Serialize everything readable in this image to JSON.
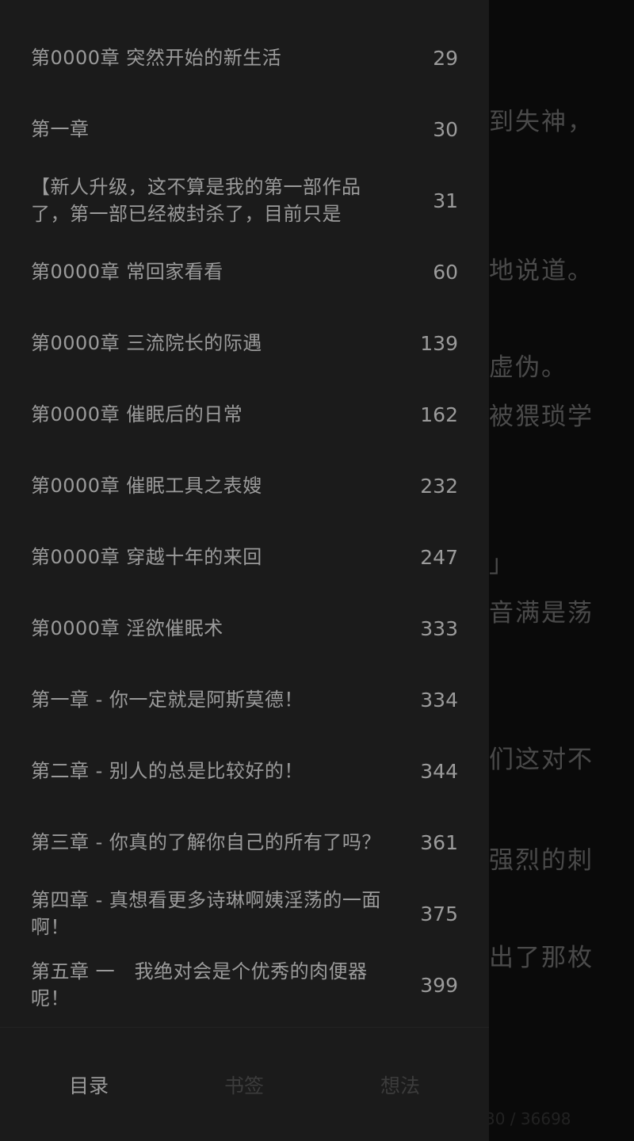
{
  "background_page": {
    "lines": [
      {
        "text": "到失神，"
      },
      {
        "text": "地说道。"
      },
      {
        "text": "虚伪。"
      },
      {
        "text": "被猥琐学"
      },
      {
        "text": "」"
      },
      {
        "text": "音满是荡"
      },
      {
        "text": "们这对不"
      },
      {
        "text": "强烈的刺"
      },
      {
        "text": "出了那枚"
      }
    ],
    "progress": "30 / 36698"
  },
  "toc": {
    "items": [
      {
        "title": "第0000章 突然开始的新生活",
        "page": "29"
      },
      {
        "title": "第一章",
        "page": "30"
      },
      {
        "title": "【新人升级，这不算是我的第一部作品了，第一部已经被封杀了，目前只是",
        "page": "31"
      },
      {
        "title": "第0000章 常回家看看",
        "page": "60"
      },
      {
        "title": "第0000章 三流院长的际遇",
        "page": "139"
      },
      {
        "title": "第0000章 催眠后的日常",
        "page": "162"
      },
      {
        "title": "第0000章 催眠工具之表嫂",
        "page": "232"
      },
      {
        "title": "第0000章 穿越十年的来回",
        "page": "247"
      },
      {
        "title": "第0000章 淫欲催眠术",
        "page": "333"
      },
      {
        "title": "第一章 - 你一定就是阿斯莫德！",
        "page": "334"
      },
      {
        "title": "第二章 - 别人的总是比较好的！",
        "page": "344"
      },
      {
        "title": "第三章 - 你真的了解你自己的所有了吗？",
        "page": "361"
      },
      {
        "title": "第四章 - 真想看更多诗琳啊姨淫荡的一面啊！",
        "page": "375"
      },
      {
        "title": "第五章 一　我绝对会是个优秀的肉便器呢！",
        "page": "399"
      }
    ]
  },
  "tabs": {
    "toc_label": "目录",
    "bookmarks_label": "书签",
    "notes_label": "想法"
  },
  "colors": {
    "drawer_bg": "#1b1b1b",
    "text": "#9b9b9b",
    "inactive_tab": "#3c3c3c"
  }
}
